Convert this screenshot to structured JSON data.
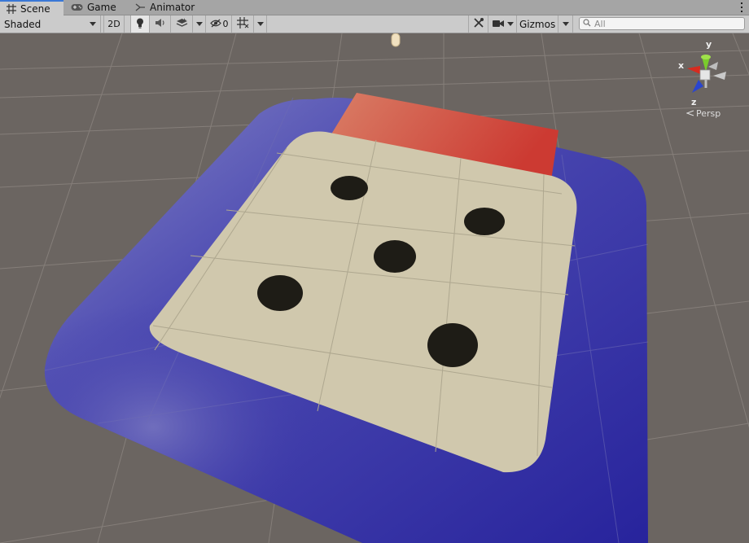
{
  "tabs": [
    {
      "label": "Scene",
      "icon": "grid-icon",
      "active": true
    },
    {
      "label": "Game",
      "icon": "gamepad-icon",
      "active": false
    },
    {
      "label": "Animator",
      "icon": "animator-icon",
      "active": false
    }
  ],
  "toolbar": {
    "shading_mode": "Shaded",
    "mode_2d_label": "2D",
    "hidden_count": "0",
    "gizmos_label": "Gizmos",
    "search_placeholder": "All"
  },
  "gizmo": {
    "axis_y": "y",
    "axis_x": "x",
    "axis_z": "z",
    "projection_label": "Persp"
  },
  "colors": {
    "viewport_bg": "#6b6561",
    "blue_plane": "#2e2aa0",
    "beige_plane": "#d0c8ad",
    "red_block": "#d44a3e",
    "dot": "#1e1c16",
    "accent": "#3a78d6"
  }
}
